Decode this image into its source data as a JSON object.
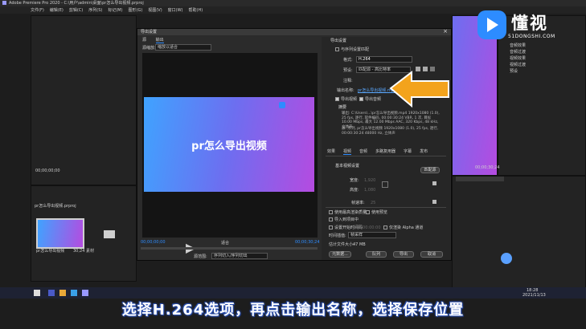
{
  "window": {
    "title": "Adobe Premiere Pro 2020 - C:\\用户\\admin\\桌面\\pr怎么导出视频.prproj"
  },
  "menu": [
    "文件(F)",
    "编辑(E)",
    "剪辑(C)",
    "序列(S)",
    "标记(M)",
    "图形(G)",
    "视图(V)",
    "窗口(W)",
    "帮助(H)"
  ],
  "dialog": {
    "title": "导出设置",
    "close": "×",
    "left_tabs": [
      "源",
      "输出"
    ],
    "source_scaling_label": "源缩放:",
    "source_scaling_value": "缩放以适合",
    "preview_text": "pr怎么导出视频",
    "export_settings_header": "导出设置",
    "match_sequence": "与序列设置匹配",
    "format_label": "格式:",
    "format_value": "H.264",
    "preset_label": "预设:",
    "preset_value": "匹配源 - 高比特率",
    "comments_label": "注释:",
    "output_name_label": "输出名称:",
    "output_name_value": "pr怎么导出视频.mp4",
    "export_video": "导出视频",
    "export_audio": "导出音频",
    "summary_header": "摘要",
    "summary_output": "输出: C:\\Users\\...\\pr怎么导出视频.mp4  1920x1080 (1.0), 25 fps, 逐行, 软件编码, 00:00:30:24  VBR, 1 次, 目标 10.00 Mbps, 最大 12.00 Mbps  AAC, 320 Kbps, 48 kHz, 立体声",
    "summary_source": "源: 序列, pr怎么导出视频  1920x1080 (1.0), 25 fps, 逐行, 00:00:30:24  48000 Hz, 立体声",
    "right_tabs": [
      "效果",
      "视频",
      "音频",
      "多路复用器",
      "字幕",
      "发布"
    ],
    "basic_video_header": "基本视频设置",
    "match_source_btn": "匹配源",
    "width_label": "宽度:",
    "width_value": "1,920",
    "height_label": "高度:",
    "height_value": "1,080",
    "frame_rate_label": "帧速率:",
    "frame_rate_value": "25",
    "max_render_quality": "使用最高渲染质量",
    "use_previews": "使用预览",
    "import_into_project": "导入到项目中",
    "set_start_timecode": "设置开始时间码",
    "start_timecode_value": "00:00:00:00",
    "render_alpha_only": "仅渲染 Alpha 通道",
    "interpolation_label": "时间插值:",
    "interpolation_value": "帧采样",
    "file_size_label": "估计文件大小:",
    "file_size_value": "47 MB",
    "btn_metadata": "元数据...",
    "btn_queue": "队列",
    "btn_export": "导出",
    "btn_cancel": "取消",
    "tc_start": "00;00;00;00",
    "tc_end": "00;00;30;24",
    "fit_label": "适合",
    "source_range_label": "源范围:",
    "source_range_value": "序列切入/序列切出"
  },
  "left_panel": {
    "timecode": "00;00;00;00",
    "project_item": "pr怎么导出视频.prproj",
    "media_label": "素材",
    "seq_label": "pr怎么导出视频",
    "duration": "30;24"
  },
  "right_panel": {
    "tc": "00;00;30;24",
    "items": [
      "音频效果",
      "音频过渡",
      "视频效果",
      "视频过渡",
      "预设"
    ]
  },
  "taskbar": {
    "time": "18:28",
    "date": "2021/11/13"
  },
  "watermark": {
    "name": "懂视",
    "url": "51DONGSHI.COM"
  },
  "caption": "选择H.264选项，再点击输出名称，选择保存位置",
  "colors": {
    "accent": "#2d8cff",
    "arrow": "#f3a31c",
    "preview_left": "#3fa3ff",
    "preview_right": "#b54be0"
  }
}
